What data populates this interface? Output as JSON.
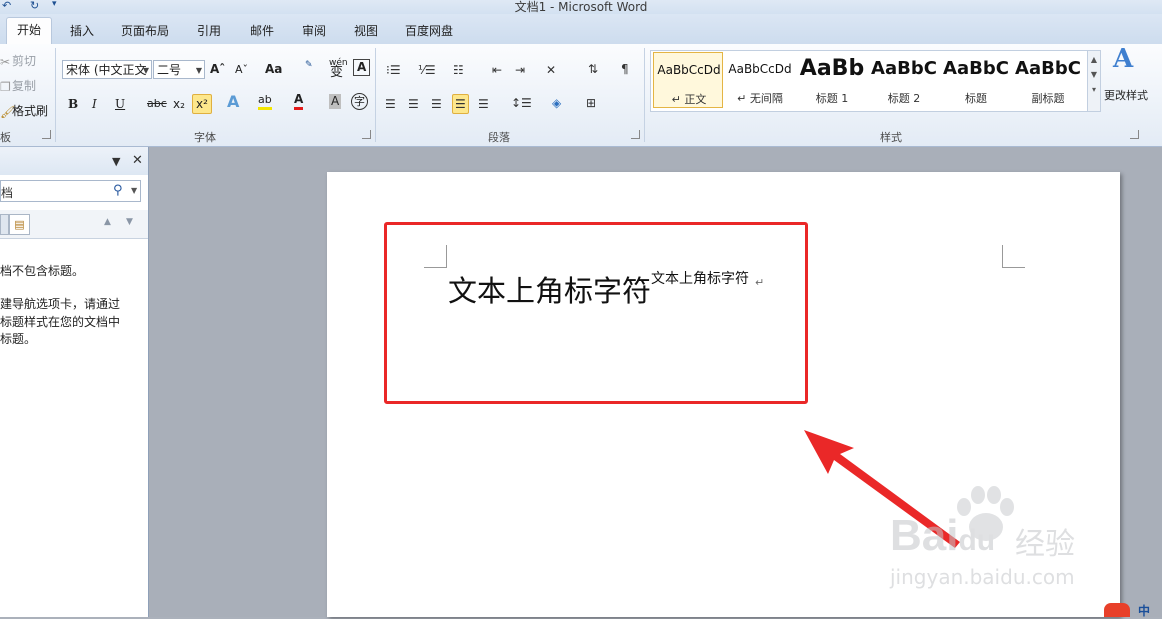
{
  "app": {
    "title": "文档1 - Microsoft Word"
  },
  "tabs": [
    {
      "label": "开始",
      "active": true
    },
    {
      "label": "插入"
    },
    {
      "label": "页面布局"
    },
    {
      "label": "引用"
    },
    {
      "label": "邮件"
    },
    {
      "label": "审阅"
    },
    {
      "label": "视图"
    },
    {
      "label": "百度网盘"
    }
  ],
  "clipboard": {
    "cut": "剪切",
    "copy": "复制",
    "format_painter": "格式刷",
    "group_label": "板"
  },
  "font": {
    "name": "宋体 (中文正文",
    "size": "二号",
    "grow": "Aˆ",
    "shrink": "Aˇ",
    "case": "Aa",
    "phonetic": "wén",
    "phonetic2": "变",
    "border_char": "A",
    "bold": "B",
    "italic": "I",
    "underline": "U",
    "strike": "abc",
    "subscript": "x₂",
    "superscript": "x²",
    "highlight": "ab",
    "color": "A",
    "shade": "A",
    "enclose": "字",
    "group_label": "字体"
  },
  "paragraph": {
    "group_label": "段落"
  },
  "styles": {
    "group_label": "样式",
    "items": [
      {
        "preview": "AaBbCcDd",
        "name": "↵ 正文",
        "selected": true
      },
      {
        "preview": "AaBbCcDd",
        "name": "↵ 无间隔"
      },
      {
        "preview": "AaBb",
        "name": "标题 1"
      },
      {
        "preview": "AaBbC",
        "name": "标题 2"
      },
      {
        "preview": "AaBbC",
        "name": "标题"
      },
      {
        "preview": "AaBbC",
        "name": "副标题"
      }
    ],
    "change_styles": "更改样式"
  },
  "nav": {
    "search_placeholder": "档",
    "message": [
      "档不包含标题。",
      "建导航选项卡，请通过",
      "标题样式在您的文档中",
      "标题。"
    ]
  },
  "document": {
    "main_text": "文本上角标字符",
    "superscript_text": "文本上角标字符",
    "paragraph_mark": "↵"
  },
  "watermark": {
    "brand": "Bai",
    "brand2": "du",
    "jingyan": "经验",
    "url": "jingyan.baidu.com"
  },
  "ime": {
    "label": "中"
  },
  "colors": {
    "annotation": "#ea2828",
    "accent": "#1d4f91"
  }
}
